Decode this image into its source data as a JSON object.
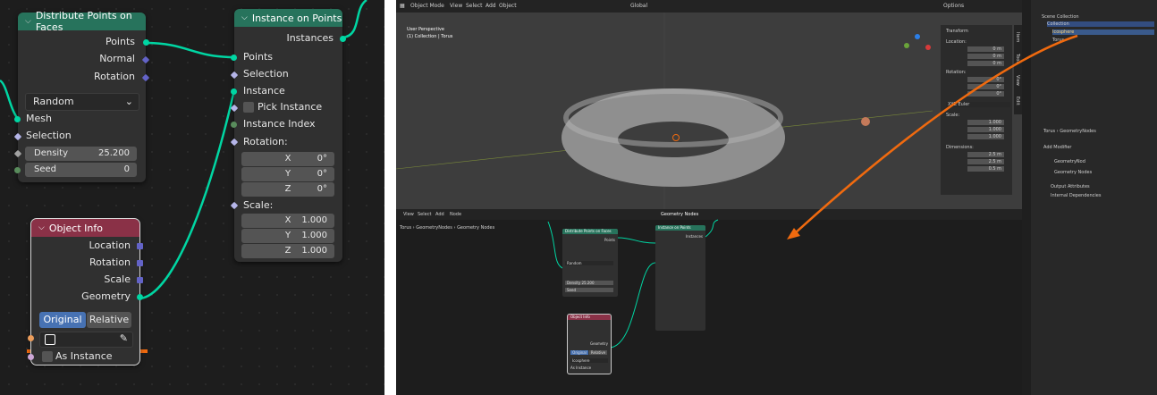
{
  "left": {
    "distribute_node": {
      "title": "Distribute Points on Faces",
      "out_points": "Points",
      "out_normal": "Normal",
      "out_rotation": "Rotation",
      "mode": "Random",
      "in_mesh": "Mesh",
      "in_selection": "Selection",
      "density_label": "Density",
      "density_value": "25.200",
      "seed_label": "Seed",
      "seed_value": "0"
    },
    "instance_node": {
      "title": "Instance on Points",
      "out_instances": "Instances",
      "in_points": "Points",
      "in_selection": "Selection",
      "in_instance": "Instance",
      "pick_instance": "Pick Instance",
      "in_instance_index": "Instance Index",
      "rotation_label": "Rotation:",
      "rot_x_label": "X",
      "rot_x_value": "0°",
      "rot_y_label": "Y",
      "rot_y_value": "0°",
      "rot_z_label": "Z",
      "rot_z_value": "0°",
      "scale_label": "Scale:",
      "sc_x_label": "X",
      "sc_x_value": "1.000",
      "sc_y_label": "Y",
      "sc_y_value": "1.000",
      "sc_z_label": "Z",
      "sc_z_value": "1.000"
    },
    "object_info_node": {
      "title": "Object Info",
      "out_location": "Location",
      "out_rotation": "Rotation",
      "out_scale": "Scale",
      "out_geometry": "Geometry",
      "btn_original": "Original",
      "btn_relative": "Relative",
      "as_instance": "As Instance"
    }
  },
  "right": {
    "topbar": {
      "mode": "Object Mode",
      "menu_view": "View",
      "menu_select": "Select",
      "menu_add": "Add",
      "menu_object": "Object",
      "orientation": "Global",
      "options": "Options"
    },
    "viewport": {
      "perspective": "User Perspective",
      "collection": "(1) Collection | Torus"
    },
    "transform_panel": {
      "title": "Transform",
      "location": "Location:",
      "loc_x": "0 m",
      "loc_y": "0 m",
      "loc_z": "0 m",
      "rotation": "Rotation:",
      "rot_x": "0°",
      "rot_y": "0°",
      "rot_z": "0°",
      "rot_mode": "XYZ Euler",
      "scale": "Scale:",
      "sc_x": "1.000",
      "sc_y": "1.000",
      "sc_z": "1.000",
      "dimensions": "Dimensions:",
      "dim_x": "2.5 m",
      "dim_y": "2.5 m",
      "dim_z": "0.5 m",
      "tab_item": "Item",
      "tab_tool": "Tool",
      "tab_view": "View",
      "tab_edit": "Edit"
    },
    "node_editor": {
      "menu_view": "View",
      "menu_select": "Select",
      "menu_add": "Add",
      "menu_node": "Node",
      "tree_name": "Geometry Nodes",
      "crumb_torus": "Torus",
      "crumb_modifier": "GeometryNodes",
      "crumb_tree": "Geometry Nodes",
      "mini_distribute": "Distribute Points on Faces",
      "mini_instance": "Instance on Points",
      "mini_objinfo": "Object Info",
      "mini_density": "Density",
      "mini_density_val": "25.200",
      "mini_seed": "Seed",
      "mini_original": "Original",
      "mini_relative": "Relative",
      "mini_obj": "Icosphere",
      "mini_as_instance": "As Instance",
      "mini_geometry": "Geometry",
      "mini_random": "Random",
      "mini_points": "Points",
      "mini_instances": "Instances"
    },
    "outliner": {
      "scene_collection": "Scene Collection",
      "collection": "Collection",
      "icosphere": "Icosphere",
      "torus": "Torus"
    },
    "properties": {
      "crumb_torus": "Torus",
      "crumb_mod": "GeometryNodes",
      "add_modifier": "Add Modifier",
      "modifier_name": "GeometryNod",
      "tree": "Geometry Nodes",
      "output_attributes": "Output Attributes",
      "internal_dependencies": "Internal Dependencies"
    }
  }
}
